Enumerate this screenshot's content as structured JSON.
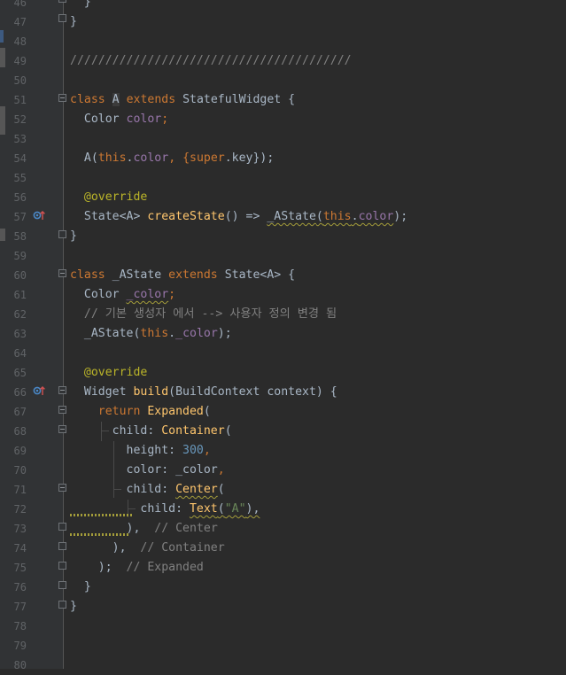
{
  "editor": {
    "language": "dart",
    "colors": {
      "background": "#2b2b2b",
      "gutter": "#313335",
      "keyword": "#cc7832",
      "field": "#9876aa",
      "method": "#ffc66d",
      "annotation": "#bbb529",
      "string": "#6a8759",
      "number": "#6897bb",
      "comment": "#808080"
    },
    "gutter_icons": {
      "line_57": "overrides-method-icon",
      "line_66": "overrides-method-icon"
    },
    "lines": [
      {
        "n": "46",
        "t": [
          "  }"
        ]
      },
      {
        "n": "47",
        "t": [
          "}"
        ]
      },
      {
        "n": "48",
        "t": [
          ""
        ]
      },
      {
        "n": "49",
        "t": [
          "////////////////////////////////////////"
        ]
      },
      {
        "n": "50",
        "t": [
          ""
        ]
      },
      {
        "n": "51",
        "t": [
          "class",
          " ",
          "A",
          " ",
          "extends",
          " StatefulWidget {"
        ]
      },
      {
        "n": "52",
        "t": [
          "  Color ",
          "color",
          ";"
        ]
      },
      {
        "n": "53",
        "t": [
          ""
        ]
      },
      {
        "n": "54",
        "t": [
          "  A(",
          "this",
          ".",
          "color",
          ", {",
          "super",
          ".key});"
        ]
      },
      {
        "n": "55",
        "t": [
          ""
        ]
      },
      {
        "n": "56",
        "t": [
          "  ",
          "@override"
        ]
      },
      {
        "n": "57",
        "t": [
          "  State<A> ",
          "createState",
          "() => ",
          "_AState",
          "(",
          "this",
          ".",
          "color",
          ");"
        ]
      },
      {
        "n": "58",
        "t": [
          "}"
        ]
      },
      {
        "n": "59",
        "t": [
          ""
        ]
      },
      {
        "n": "60",
        "t": [
          "class",
          " _AState ",
          "extends",
          " State<A> {"
        ]
      },
      {
        "n": "61",
        "t": [
          "  Color ",
          "_color",
          ";"
        ]
      },
      {
        "n": "62",
        "t": [
          "  // 기본 생성자 에서 --> 사용자 정의 변경 됨"
        ]
      },
      {
        "n": "63",
        "t": [
          "  _AState(",
          "this",
          ".",
          "_color",
          ");"
        ]
      },
      {
        "n": "64",
        "t": [
          ""
        ]
      },
      {
        "n": "65",
        "t": [
          "  ",
          "@override"
        ]
      },
      {
        "n": "66",
        "t": [
          "  Widget ",
          "build",
          "(BuildContext context) {"
        ]
      },
      {
        "n": "67",
        "t": [
          "    ",
          "return",
          " ",
          "Expanded",
          "("
        ]
      },
      {
        "n": "68",
        "t": [
          "      child: ",
          "Container",
          "("
        ]
      },
      {
        "n": "69",
        "t": [
          "        height: ",
          "300",
          ","
        ]
      },
      {
        "n": "70",
        "t": [
          "        color: _color",
          ","
        ]
      },
      {
        "n": "71",
        "t": [
          "        child: ",
          "Center",
          "("
        ]
      },
      {
        "n": "72",
        "t": [
          "          child: ",
          "Text",
          "(",
          "\"A\"",
          "),"
        ]
      },
      {
        "n": "73",
        "t": [
          "        ",
          "),",
          "  // Center"
        ]
      },
      {
        "n": "74",
        "t": [
          "      ",
          "),",
          "  // Container"
        ]
      },
      {
        "n": "75",
        "t": [
          "    ",
          ");",
          "  // Expanded"
        ]
      },
      {
        "n": "76",
        "t": [
          "  }"
        ]
      },
      {
        "n": "77",
        "t": [
          "}"
        ]
      },
      {
        "n": "78",
        "t": [
          ""
        ]
      },
      {
        "n": "79",
        "t": [
          ""
        ]
      },
      {
        "n": "80",
        "t": [
          ""
        ]
      }
    ]
  }
}
